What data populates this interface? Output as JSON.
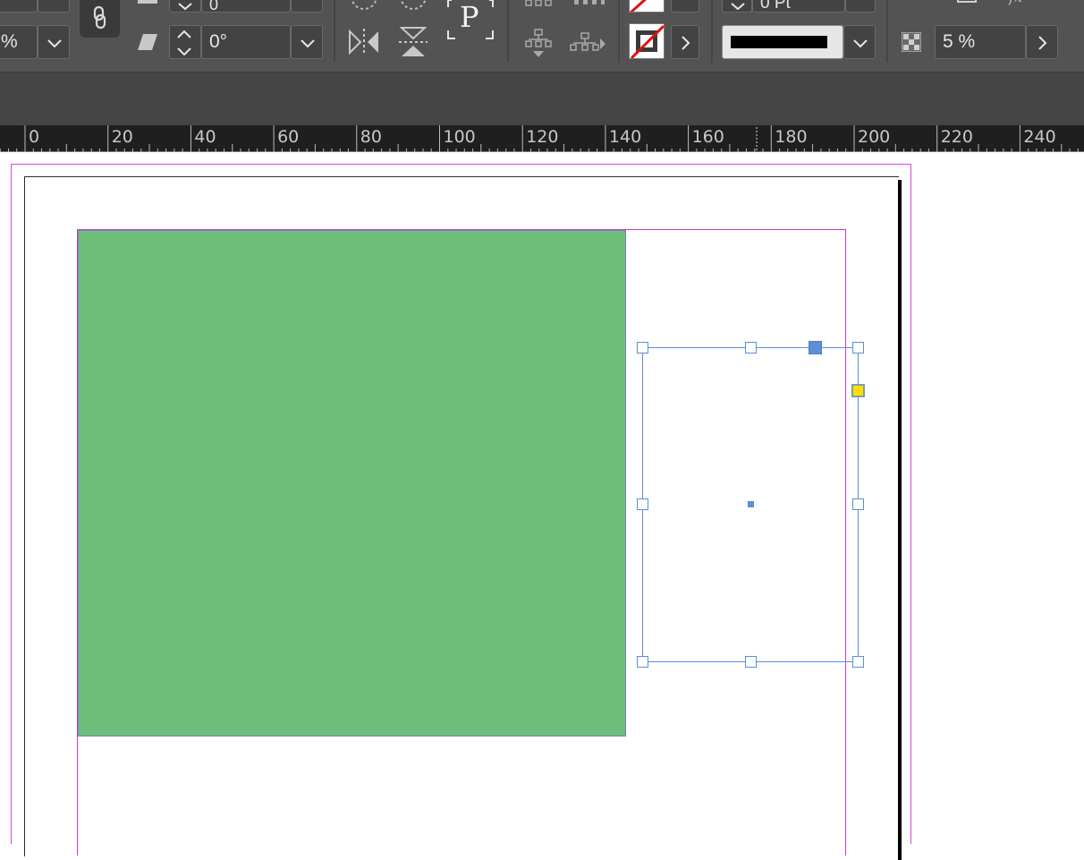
{
  "control_bar": {
    "shear_angle_value": "0°",
    "stroke_weight_partial": "0 Pt",
    "reference_point_label": "P",
    "opacity_value": "5 %",
    "stroke_color": "#000000",
    "fill_swatch": "none",
    "stroke_swatch": "none-red-slash"
  },
  "ruler": {
    "unit_labels": [
      "0",
      "20",
      "40",
      "60",
      "80",
      "100",
      "120",
      "140",
      "160",
      "180",
      "200",
      "220",
      "240"
    ]
  },
  "document": {
    "green_rectangle_color": "#6fbd7a",
    "margin_guide_color": "#c13fc8",
    "selection_color": "#5b8fd6",
    "text_frame_outport_color": "#ffe000"
  },
  "colors": {
    "ui_background": "#535353",
    "pasteboard_dark": "#454545",
    "ruler_background": "#1f1f1f"
  }
}
